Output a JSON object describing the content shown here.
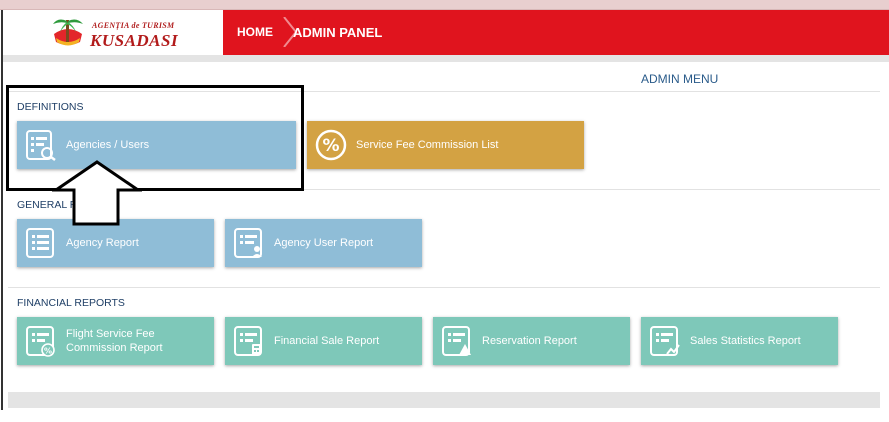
{
  "logo": {
    "line1": "AGENȚIA de TURISM",
    "line2": "KUSADASI"
  },
  "breadcrumb": {
    "home": "HOME",
    "current": "ADMIN PANEL"
  },
  "admin_menu_title": "ADMIN MENU",
  "sections": {
    "definitions": {
      "title": "DEFINITIONS",
      "tiles": [
        {
          "label": "Agencies / Users",
          "color": "#8fbdd7",
          "icon": "list-search-icon"
        },
        {
          "label": "Service Fee Commission List",
          "color": "#d3a243",
          "icon": "percent-icon"
        }
      ]
    },
    "general": {
      "title": "GENERAL R",
      "tiles": [
        {
          "label": "Agency Report",
          "color": "#8fbdd7",
          "icon": "list-icon"
        },
        {
          "label": "Agency User Report",
          "color": "#8fbdd7",
          "icon": "list-user-icon"
        }
      ]
    },
    "financial": {
      "title": "FINANCIAL REPORTS",
      "tiles": [
        {
          "label": "Flight Service Fee Commission Report",
          "color": "#7ec8b9",
          "icon": "list-percent-icon"
        },
        {
          "label": "Financial Sale Report",
          "color": "#7ec8b9",
          "icon": "list-calculator-icon"
        },
        {
          "label": "Reservation Report",
          "color": "#7ec8b9",
          "icon": "list-warning-icon"
        },
        {
          "label": "Sales Statistics Report",
          "color": "#7ec8b9",
          "icon": "list-chart-icon"
        }
      ]
    }
  },
  "colors": {
    "header_red": "#e0141e",
    "tile_blue": "#8fbdd7",
    "tile_green": "#7ec8b9",
    "tile_gold": "#d3a243"
  }
}
